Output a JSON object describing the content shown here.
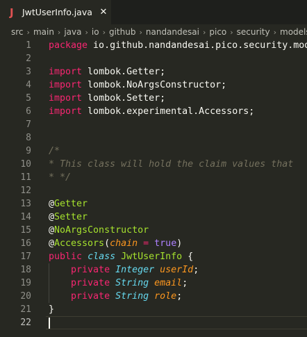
{
  "tab": {
    "icon_letter": "J",
    "file_name": "JwtUserInfo.java",
    "close_glyph": "✕"
  },
  "breadcrumb": [
    "src",
    "main",
    "java",
    "io",
    "github",
    "nandandesai",
    "pico",
    "security",
    "models"
  ],
  "breadcrumb_separator": "›",
  "lines": [
    {
      "n": "1",
      "tokens": [
        [
          "k",
          "package"
        ],
        [
          "w",
          " io.github.nandandesai.pico.security.models;"
        ]
      ]
    },
    {
      "n": "2",
      "tokens": []
    },
    {
      "n": "3",
      "tokens": [
        [
          "k",
          "import"
        ],
        [
          "w",
          " lombok.Getter;"
        ]
      ]
    },
    {
      "n": "4",
      "tokens": [
        [
          "k",
          "import"
        ],
        [
          "w",
          " lombok.NoArgsConstructor;"
        ]
      ]
    },
    {
      "n": "5",
      "tokens": [
        [
          "k",
          "import"
        ],
        [
          "w",
          " lombok.Setter;"
        ]
      ]
    },
    {
      "n": "6",
      "tokens": [
        [
          "k",
          "import"
        ],
        [
          "w",
          " lombok.experimental.Accessors;"
        ]
      ]
    },
    {
      "n": "7",
      "tokens": []
    },
    {
      "n": "8",
      "tokens": []
    },
    {
      "n": "9",
      "tokens": [
        [
          "c",
          "/*"
        ]
      ]
    },
    {
      "n": "10",
      "tokens": [
        [
          "c",
          "* This class will hold the claim values that"
        ]
      ]
    },
    {
      "n": "11",
      "tokens": [
        [
          "c",
          "* */"
        ]
      ]
    },
    {
      "n": "12",
      "tokens": []
    },
    {
      "n": "13",
      "tokens": [
        [
          "w",
          "@"
        ],
        [
          "a",
          "Getter"
        ]
      ]
    },
    {
      "n": "14",
      "tokens": [
        [
          "w",
          "@"
        ],
        [
          "a",
          "Setter"
        ]
      ]
    },
    {
      "n": "15",
      "tokens": [
        [
          "w",
          "@"
        ],
        [
          "a",
          "NoArgsConstructor"
        ]
      ]
    },
    {
      "n": "16",
      "tokens": [
        [
          "w",
          "@"
        ],
        [
          "a",
          "Accessors"
        ],
        [
          "w",
          "("
        ],
        [
          "p",
          "chain"
        ],
        [
          "w",
          " "
        ],
        [
          "k",
          "="
        ],
        [
          "w",
          " "
        ],
        [
          "b",
          "true"
        ],
        [
          "w",
          ")"
        ]
      ]
    },
    {
      "n": "17",
      "tokens": [
        [
          "k",
          "public"
        ],
        [
          "w",
          " "
        ],
        [
          "t",
          "class"
        ],
        [
          "w",
          " "
        ],
        [
          "a",
          "JwtUserInfo"
        ],
        [
          "w",
          " {"
        ]
      ]
    },
    {
      "n": "18",
      "tokens": [
        [
          "w",
          "    "
        ],
        [
          "k",
          "private"
        ],
        [
          "w",
          " "
        ],
        [
          "t",
          "Integer"
        ],
        [
          "w",
          " "
        ],
        [
          "p",
          "userId"
        ],
        [
          "w",
          ";"
        ]
      ]
    },
    {
      "n": "19",
      "tokens": [
        [
          "w",
          "    "
        ],
        [
          "k",
          "private"
        ],
        [
          "w",
          " "
        ],
        [
          "t",
          "String"
        ],
        [
          "w",
          " "
        ],
        [
          "p",
          "email"
        ],
        [
          "w",
          ";"
        ]
      ]
    },
    {
      "n": "20",
      "tokens": [
        [
          "w",
          "    "
        ],
        [
          "k",
          "private"
        ],
        [
          "w",
          " "
        ],
        [
          "t",
          "String"
        ],
        [
          "w",
          " "
        ],
        [
          "p",
          "role"
        ],
        [
          "w",
          ";"
        ]
      ]
    },
    {
      "n": "21",
      "tokens": [
        [
          "w",
          "}"
        ]
      ]
    },
    {
      "n": "22",
      "tokens": []
    }
  ],
  "current_line": "22",
  "colors": {
    "background": "#272822",
    "tabbar": "#1e1f1c",
    "keyword": "#f92672",
    "type": "#66d9ef",
    "annotation": "#a6e22e",
    "comment": "#75715e",
    "constant": "#ae81ff",
    "parameter": "#fd971f",
    "text": "#f8f8f2"
  }
}
